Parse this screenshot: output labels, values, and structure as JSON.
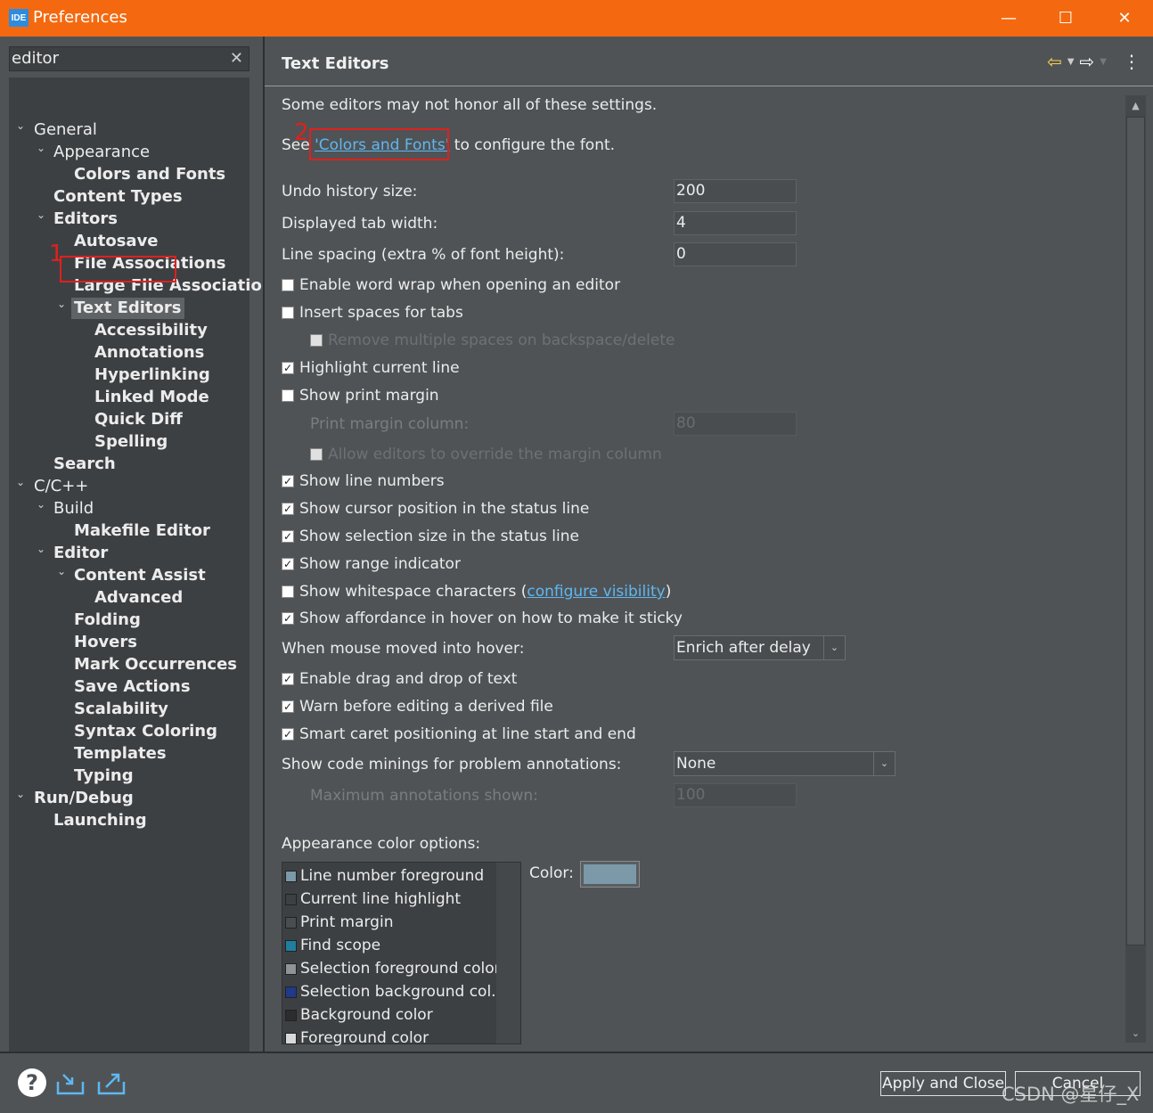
{
  "window": {
    "app_icon_text": "IDE",
    "title": "Preferences",
    "minimize": "—",
    "maximize": "☐",
    "close": "✕"
  },
  "search": {
    "value": "editor",
    "clear": "✕"
  },
  "tree": {
    "general": "General",
    "appearance": "Appearance",
    "colors_and_fonts": "Colors and Fonts",
    "content_types": "Content Types",
    "editors": "Editors",
    "autosave": "Autosave",
    "file_associations": "File Associations",
    "large_file_associations": "Large File Associations",
    "text_editors": "Text Editors",
    "accessibility": "Accessibility",
    "annotations": "Annotations",
    "hyperlinking": "Hyperlinking",
    "linked_mode": "Linked Mode",
    "quick_diff": "Quick Diff",
    "spelling": "Spelling",
    "search": "Search",
    "cpp": "C/C++",
    "build": "Build",
    "makefile_editor": "Makefile Editor",
    "editor": "Editor",
    "content_assist": "Content Assist",
    "advanced": "Advanced",
    "folding": "Folding",
    "hovers": "Hovers",
    "mark_occurrences": "Mark Occurrences",
    "save_actions": "Save Actions",
    "scalability": "Scalability",
    "syntax_coloring": "Syntax Coloring",
    "templates": "Templates",
    "typing": "Typing",
    "run_debug": "Run/Debug",
    "launching": "Launching"
  },
  "page": {
    "title": "Text Editors",
    "note": "Some editors may not honor all of these settings.",
    "see_prefix": "See ",
    "see_link": "'Colors and Fonts'",
    "see_suffix": " to configure the font.",
    "undo_label": "Undo history size:",
    "undo_value": "200",
    "tab_label": "Displayed tab width:",
    "tab_value": "4",
    "spacing_label": "Line spacing (extra % of font height):",
    "spacing_value": "0",
    "word_wrap": "Enable word wrap when opening an editor",
    "insert_spaces": "Insert spaces for tabs",
    "remove_spaces": "Remove multiple spaces on backspace/delete",
    "highlight_line": "Highlight current line",
    "print_margin": "Show print margin",
    "margin_column_label": "Print margin column:",
    "margin_column_value": "80",
    "allow_override": "Allow editors to override the margin column",
    "line_numbers": "Show line numbers",
    "cursor_position": "Show cursor position in the status line",
    "selection_size": "Show selection size in the status line",
    "range_indicator": "Show range indicator",
    "whitespace_prefix": "Show whitespace characters (",
    "whitespace_link": "configure visibility",
    "whitespace_suffix": ")",
    "affordance": "Show affordance in hover on how to make it sticky",
    "hover_label": "When mouse moved into hover:",
    "hover_value": "Enrich after delay",
    "drag_drop": "Enable drag and drop of text",
    "warn_derived": "Warn before editing a derived file",
    "smart_caret": "Smart caret positioning at line start and end",
    "minings_label": "Show code minings for problem annotations:",
    "minings_value": "None",
    "max_annotations_label": "Maximum annotations shown:",
    "max_annotations_value": "100",
    "appearance_label": "Appearance color options:",
    "color_label": "Color:",
    "color_options": [
      {
        "label": "Line number foreground",
        "swatch": "#7b99a9"
      },
      {
        "label": "Current line highlight",
        "swatch": "#3d4043"
      },
      {
        "label": "Print margin",
        "swatch": "#4a4d50"
      },
      {
        "label": "Find scope",
        "swatch": "#1e7fa0"
      },
      {
        "label": "Selection foreground color",
        "swatch": "#8f9396"
      },
      {
        "label": "Selection background col...",
        "swatch": "#1f3a8a"
      },
      {
        "label": "Background color",
        "swatch": "#2b2d2f"
      },
      {
        "label": "Foreground color",
        "swatch": "#d9d9d9"
      }
    ],
    "selected_color": "#7b99a9"
  },
  "annotations": {
    "one": "1",
    "two": "2"
  },
  "buttons": {
    "apply_close": "Apply and Close",
    "cancel": "Cancel",
    "help": "?"
  },
  "watermark": "CSDN @星仔_X"
}
